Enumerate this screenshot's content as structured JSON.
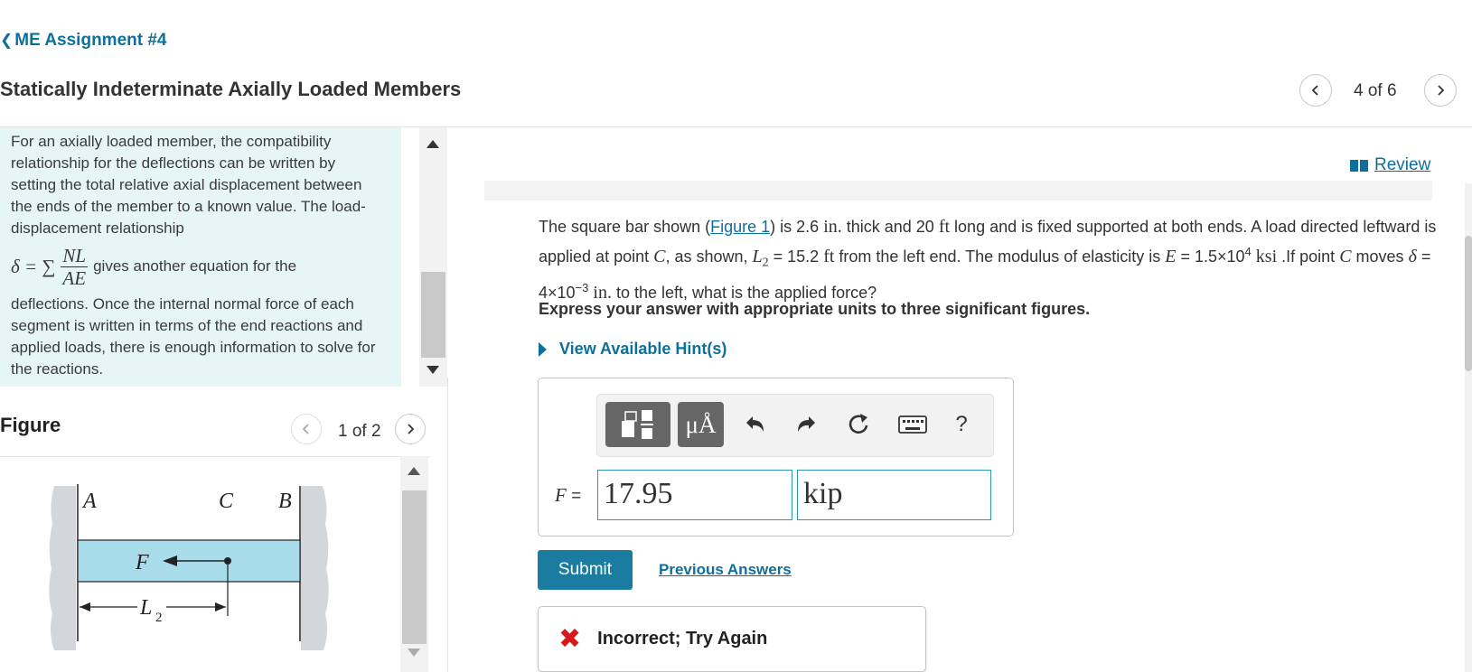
{
  "header": {
    "back_label": "ME Assignment #4",
    "title": "Statically Indeterminate Axially Loaded Members",
    "page_count": "4 of 6"
  },
  "intro": {
    "para1": "For an axially loaded member, the compatibility relationship for the deflections can be written by setting the total relative axial displacement between the ends of the member to a known value. The load-displacement relationship",
    "formula_lhs": "δ = ∑",
    "formula_num": "NL",
    "formula_den": "AE",
    "formula_tail": "gives another equation for the",
    "para2": "deflections. Once the internal normal force of each segment is written in terms of the end reactions and applied loads, there is enough information to solve for the reactions."
  },
  "figure": {
    "label": "Figure",
    "count": "1 of 2",
    "labels": {
      "a": "A",
      "b": "B",
      "c": "C",
      "f": "F",
      "l": "L",
      "l_sub": "2"
    }
  },
  "review": {
    "label": "Review"
  },
  "problem": {
    "t1": "The square bar shown (",
    "fig_link": "Figure 1",
    "t2": ") is 2.6 ",
    "u_in": "in.",
    "t3": " thick and 20 ",
    "u_ft": "ft",
    "t4": " long and is fixed supported at both ends. A load directed leftward is applied at point ",
    "var_c": "C",
    "t5": ", as shown, ",
    "var_l": "L",
    "var_l_sub": "2",
    "t6": " = 15.2 ",
    "u_ft2": "ft",
    "t7": " from the left end. The modulus of elasticity is ",
    "var_e": "E",
    "t8": " = 1.5×10",
    "exp4": "4",
    "u_ksi": "ksi",
    "t9": " .If point ",
    "var_c2": "C",
    "t10": " moves ",
    "var_delta": "δ",
    "t11": " = 4×10",
    "exp_neg3": "−3",
    "u_in2": "in.",
    "t12": " to the left, what is the applied force?"
  },
  "instruction": "Express your answer with appropriate units to three significant figures.",
  "hints_label": "View Available Hint(s)",
  "toolbar": {
    "templates_icon": "templates-icon",
    "units_label": "μÅ",
    "undo_icon": "undo-icon",
    "redo_icon": "redo-icon",
    "reset_icon": "reset-icon",
    "keyboard_icon": "keyboard-icon",
    "help_label": "?"
  },
  "answer": {
    "var_label": "F",
    "equals": "=",
    "value": "17.95",
    "unit": "kip"
  },
  "submit_label": "Submit",
  "previous_answers_label": "Previous Answers",
  "feedback": {
    "icon": "✖",
    "message": "Incorrect; Try Again"
  },
  "colors": {
    "accent": "#0d6f9c",
    "submit_bg": "#1a7ca1",
    "intro_bg": "#e6f6f7",
    "error": "#d7191c",
    "bar_fill": "#a8dceb"
  }
}
